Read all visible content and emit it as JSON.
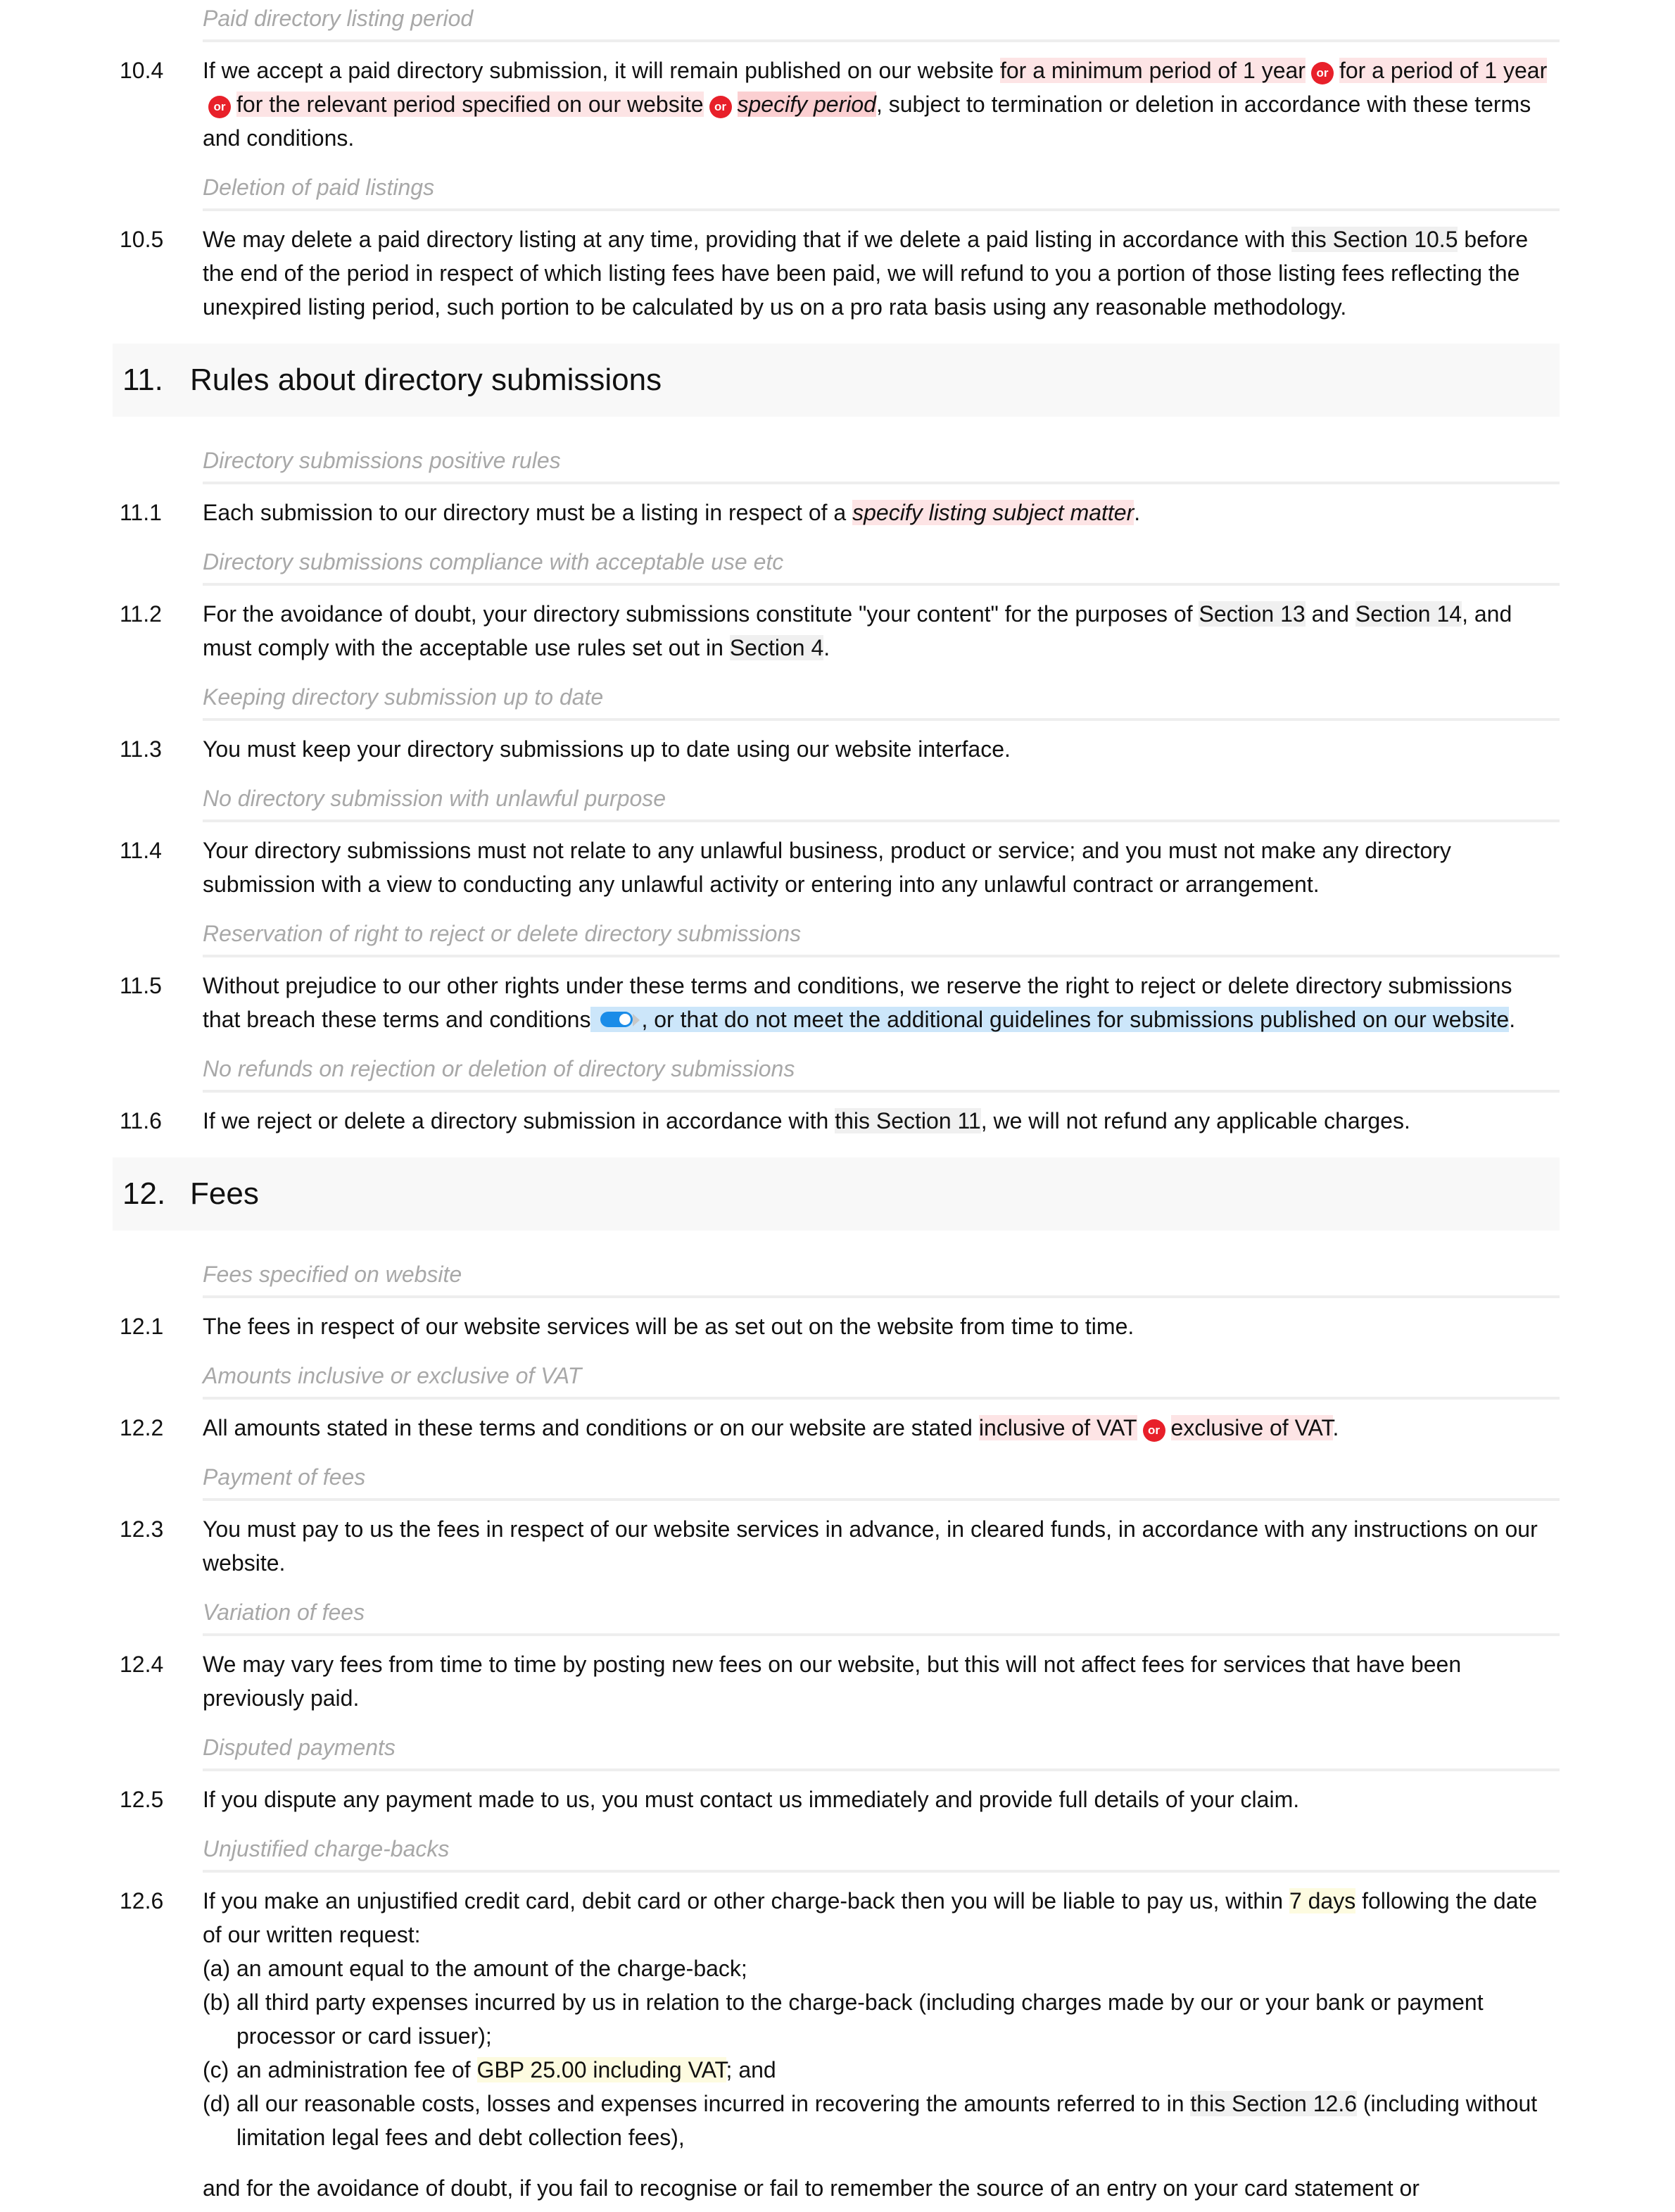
{
  "s10": {
    "sub_10_4": "Paid directory listing period",
    "c10_4": {
      "num": "10.4",
      "t1": "If we accept a paid directory submission, it will remain published on our website ",
      "opt1": "for a minimum period of 1 year",
      "or": "or",
      "opt2": "for a period of 1 year",
      "opt3": "for the relevant period specified on our website",
      "opt4": "specify period",
      "t2": ", subject to termination or deletion in accordance with these terms and conditions."
    },
    "sub_10_5": "Deletion of paid listings",
    "c10_5": {
      "num": "10.5",
      "t1": "We may delete a paid directory listing at any time, providing that if we delete a paid listing in accordance with ",
      "ref": "this Section 10.5",
      "t2": " before the end of the period in respect of which listing fees have been paid, we will refund to you a portion of those listing fees reflecting the unexpired listing period, such portion to be calculated by us on a pro rata basis using any reasonable methodology."
    }
  },
  "s11": {
    "num": "11.",
    "title": "Rules about directory submissions",
    "sub_11_1": "Directory submissions positive rules",
    "c11_1": {
      "num": "11.1",
      "t1": "Each submission to our directory must be a listing in respect of a ",
      "opt": "specify listing subject matter",
      "t2": "."
    },
    "sub_11_2": "Directory submissions compliance with acceptable use etc",
    "c11_2": {
      "num": "11.2",
      "t1": "For the avoidance of doubt, your directory submissions constitute \"your content\" for the purposes of ",
      "ref1": "Section 13",
      "t2": " and ",
      "ref2": "Section 14",
      "t3": ", and must comply with the acceptable use rules set out in ",
      "ref3": "Section 4",
      "t4": "."
    },
    "sub_11_3": "Keeping directory submission up to date",
    "c11_3": {
      "num": "11.3",
      "t1": "You must keep your directory submissions up to date using our website interface."
    },
    "sub_11_4": "No directory submission with unlawful purpose",
    "c11_4": {
      "num": "11.4",
      "t1": "Your directory submissions must not relate to any unlawful business, product or service; and you must not make any directory submission with a view to conducting any unlawful activity or entering into any unlawful contract or arrangement."
    },
    "sub_11_5": "Reservation of right to reject or delete directory submissions",
    "c11_5": {
      "num": "11.5",
      "t1": "Without prejudice to our other rights under these terms and conditions, we reserve the right to reject or delete directory submissions that breach these terms and conditions",
      "toggle_on": true,
      "opt": ", or that do not meet the additional guidelines for submissions published on our website",
      "t2": "."
    },
    "sub_11_6": "No refunds on rejection or deletion of directory submissions",
    "c11_6": {
      "num": "11.6",
      "t1": "If we reject or delete a directory submission in accordance with ",
      "ref": "this Section 11",
      "t2": ", we will not refund any applicable charges."
    }
  },
  "s12": {
    "num": "12.",
    "title": "Fees",
    "sub_12_1": "Fees specified on website",
    "c12_1": {
      "num": "12.1",
      "t1": "The fees in respect of our website services will be as set out on the website from time to time."
    },
    "sub_12_2": "Amounts inclusive or exclusive of VAT",
    "c12_2": {
      "num": "12.2",
      "t1": "All amounts stated in these terms and conditions or on our website are stated ",
      "opt1": "inclusive of VAT",
      "or": "or",
      "opt2": "exclusive of VAT",
      "t2": "."
    },
    "sub_12_3": "Payment of fees",
    "c12_3": {
      "num": "12.3",
      "t1": "You must pay to us the fees in respect of our website services in advance, in cleared funds, in accordance with any instructions on our website."
    },
    "sub_12_4": "Variation of fees",
    "c12_4": {
      "num": "12.4",
      "t1": "We may vary fees from time to time by posting new fees on our website, but this will not affect fees for services that have been previously paid."
    },
    "sub_12_5": "Disputed payments",
    "c12_5": {
      "num": "12.5",
      "t1": "If you dispute any payment made to us, you must contact us immediately and provide full details of your claim."
    },
    "sub_12_6": "Unjustified charge-backs",
    "c12_6": {
      "num": "12.6",
      "t1": "If you make an unjustified credit card, debit card or other charge-back then you will be liable to pay us, within ",
      "days": "7 days",
      "t2": " following the date of our written request:",
      "a_lbl": "(a)",
      "a": "an amount equal to the amount of the charge-back;",
      "b_lbl": "(b)",
      "b": "all third party expenses incurred by us in relation to the charge-back (including charges made by our or your bank or payment processor or card issuer);",
      "c_lbl": "(c)",
      "c1": "an administration fee of ",
      "c_amt": "GBP 25.00 including VAT",
      "c2": "; and",
      "d_lbl": "(d)",
      "d1": "all our reasonable costs, losses and expenses incurred in recovering the amounts referred to in ",
      "d_ref": "this Section 12.6",
      "d2": " (including without limitation legal fees and debt collection fees),",
      "trail": "and for the avoidance of doubt, if you fail to recognise or fail to remember the source of an entry on your card statement or"
    }
  }
}
